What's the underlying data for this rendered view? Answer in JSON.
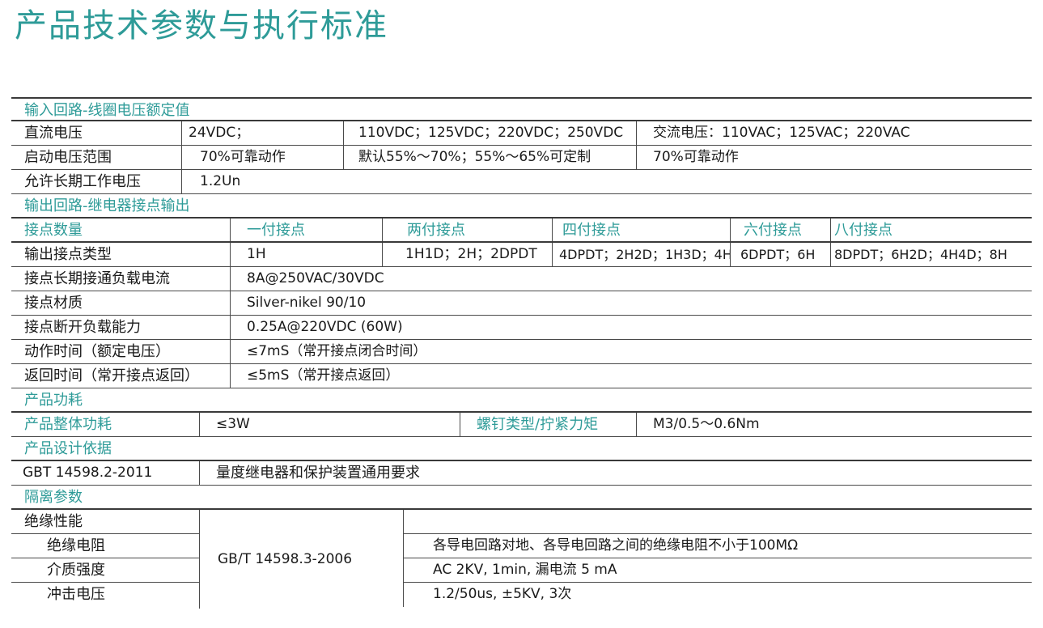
{
  "title": "产品技术参数与执行标准",
  "input": {
    "section": "输入回路-线圈电压额定值",
    "rows": [
      {
        "label": "直流电压",
        "c1": "24VDC；",
        "c2": "110VDC；125VDC；220VDC；250VDC",
        "c3": "交流电压：110VAC；125VAC；220VAC"
      },
      {
        "label": "启动电压范围",
        "c1": "70%可靠动作",
        "c2": "默认55%～70%；55%～65%可定制",
        "c3": "70%可靠动作"
      },
      {
        "label": "允许长期工作电压",
        "c1": "1.2Un"
      }
    ]
  },
  "output": {
    "section": "输出回路-继电器接点输出",
    "header": {
      "label": "接点数量",
      "cols": [
        "一付接点",
        "两付接点",
        "四付接点",
        "六付接点",
        "八付接点"
      ]
    },
    "types": {
      "label": "输出接点类型",
      "cols": [
        "1H",
        "1H1D；2H；2DPDT",
        "4DPDT；2H2D；1H3D；4H",
        "6DPDT；6H",
        "8DPDT；6H2D；4H4D；8H"
      ]
    },
    "rows": [
      {
        "label": "接点长期接通负载电流",
        "value": "8A@250VAC/30VDC"
      },
      {
        "label": "接点材质",
        "value": "Silver-nikel 90/10"
      },
      {
        "label": "接点断开负载能力",
        "value": "0.25A@220VDC (60W)"
      },
      {
        "label": "动作时间（额定电压）",
        "value": "≤7mS（常开接点闭合时间）"
      },
      {
        "label": "返回时间（常开接点返回）",
        "value": "≤5mS（常开接点返回）"
      }
    ]
  },
  "power": {
    "section": "产品功耗",
    "label": "产品整体功耗",
    "value": "≤3W",
    "screw_label": "螺钉类型/拧紧力矩",
    "screw_value": "M3/0.5～0.6Nm"
  },
  "design": {
    "section": "产品设计依据",
    "standard": "GBT 14598.2-2011",
    "desc": "量度继电器和保护装置通用要求"
  },
  "isolation": {
    "section": "隔离参数",
    "group_label": "绝缘性能",
    "standard": "GB/T 14598.3-2006",
    "rows": [
      {
        "label": "绝缘电阻",
        "value": "各导电回路对地、各导电回路之间的绝缘电阻不小于100MΩ"
      },
      {
        "label": "介质强度",
        "value": "AC 2KV, 1min, 漏电流 5 mA"
      },
      {
        "label": "冲击电压",
        "value": "1.2/50us, ±5KV, 3次"
      }
    ]
  }
}
